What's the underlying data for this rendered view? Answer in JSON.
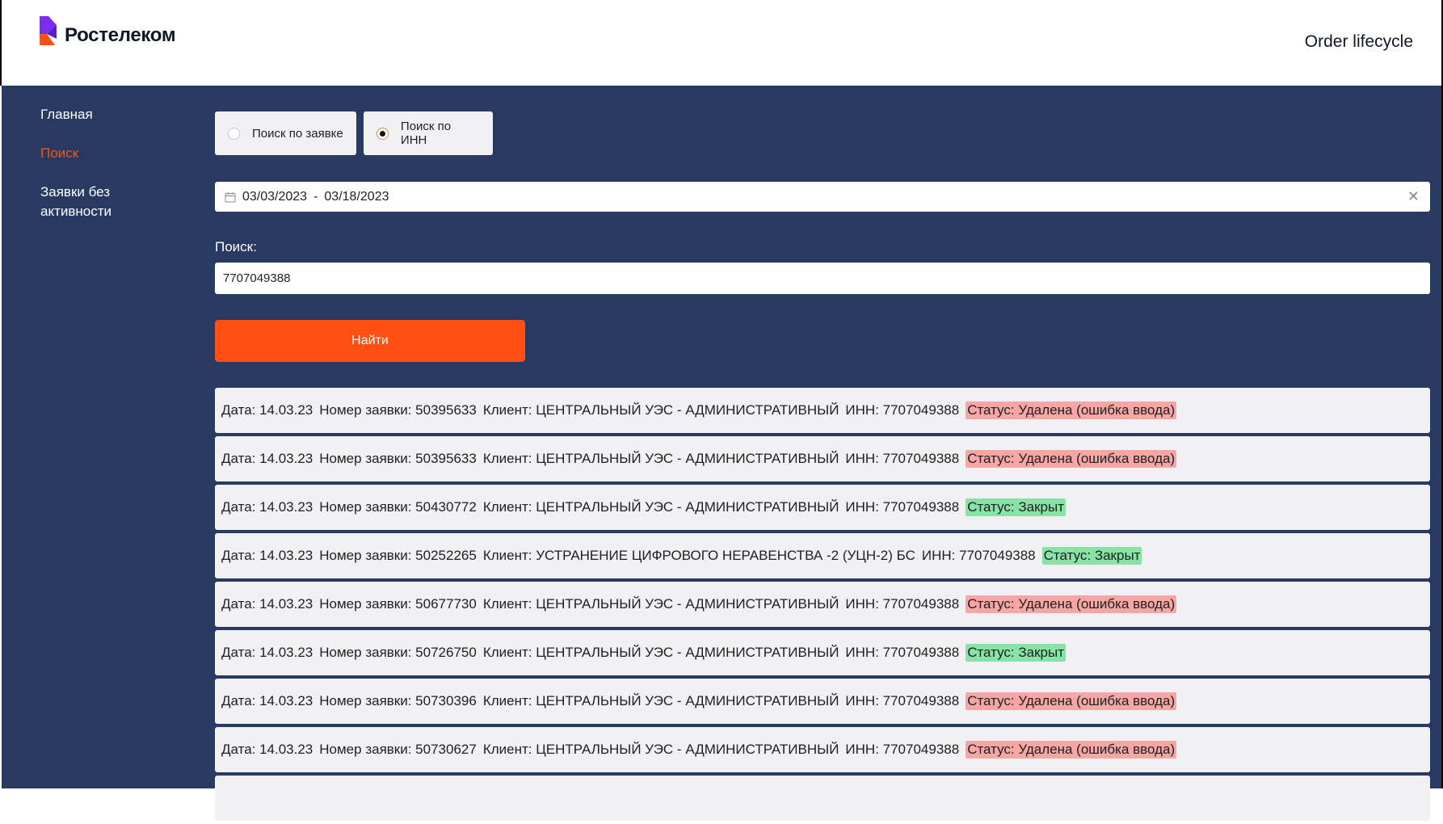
{
  "header": {
    "logo_text": "Ростелеком",
    "title": "Order lifecycle"
  },
  "sidebar": {
    "items": [
      {
        "label": "Главная",
        "active": false
      },
      {
        "label": "Поиск",
        "active": true
      },
      {
        "label": "Заявки без активности",
        "active": false
      }
    ]
  },
  "search_mode": {
    "options": [
      {
        "label": "Поиск по заявке",
        "checked": false
      },
      {
        "label": "Поиск по ИНН",
        "checked": true
      }
    ]
  },
  "date_range": {
    "start": "03/03/2023",
    "separator": "-",
    "end": "03/18/2023"
  },
  "search": {
    "label": "Поиск:",
    "value": "7707049388"
  },
  "find_button": {
    "label": "Найти"
  },
  "colors": {
    "accent": "#ff4f12",
    "background": "#283a62",
    "status_deleted": "#f7a6a6",
    "status_closed": "#87e3a6"
  },
  "results": [
    {
      "date": "Дата: 14.03.23",
      "order": "Номер заявки: 50395633",
      "client": "Клиент: ЦЕНТРАЛЬНЫЙ УЭС - АДМИНИСТРАТИВНЫЙ",
      "inn": "ИНН: 7707049388",
      "status": "Статус: Удалена (ошибка ввода)",
      "status_type": "deleted"
    },
    {
      "date": "Дата: 14.03.23",
      "order": "Номер заявки: 50395633",
      "client": "Клиент: ЦЕНТРАЛЬНЫЙ УЭС - АДМИНИСТРАТИВНЫЙ",
      "inn": "ИНН: 7707049388",
      "status": "Статус: Удалена (ошибка ввода)",
      "status_type": "deleted"
    },
    {
      "date": "Дата: 14.03.23",
      "order": "Номер заявки: 50430772",
      "client": "Клиент: ЦЕНТРАЛЬНЫЙ УЭС - АДМИНИСТРАТИВНЫЙ",
      "inn": "ИНН: 7707049388",
      "status": "Статус: Закрыт",
      "status_type": "closed"
    },
    {
      "date": "Дата: 14.03.23",
      "order": "Номер заявки: 50252265",
      "client": "Клиент: УСТРАНЕНИЕ ЦИФРОВОГО НЕРАВЕНСТВА -2 (УЦН-2) БС",
      "inn": "ИНН: 7707049388",
      "status": "Статус: Закрыт",
      "status_type": "closed"
    },
    {
      "date": "Дата: 14.03.23",
      "order": "Номер заявки: 50677730",
      "client": "Клиент: ЦЕНТРАЛЬНЫЙ УЭС - АДМИНИСТРАТИВНЫЙ",
      "inn": "ИНН: 7707049388",
      "status": "Статус: Удалена (ошибка ввода)",
      "status_type": "deleted"
    },
    {
      "date": "Дата: 14.03.23",
      "order": "Номер заявки: 50726750",
      "client": "Клиент: ЦЕНТРАЛЬНЫЙ УЭС - АДМИНИСТРАТИВНЫЙ",
      "inn": "ИНН: 7707049388",
      "status": "Статус: Закрыт",
      "status_type": "closed"
    },
    {
      "date": "Дата: 14.03.23",
      "order": "Номер заявки: 50730396",
      "client": "Клиент: ЦЕНТРАЛЬНЫЙ УЭС - АДМИНИСТРАТИВНЫЙ",
      "inn": "ИНН: 7707049388",
      "status": "Статус: Удалена (ошибка ввода)",
      "status_type": "deleted"
    },
    {
      "date": "Дата: 14.03.23",
      "order": "Номер заявки: 50730627",
      "client": "Клиент: ЦЕНТРАЛЬНЫЙ УЭС - АДМИНИСТРАТИВНЫЙ",
      "inn": "ИНН: 7707049388",
      "status": "Статус: Удалена (ошибка ввода)",
      "status_type": "deleted"
    }
  ]
}
